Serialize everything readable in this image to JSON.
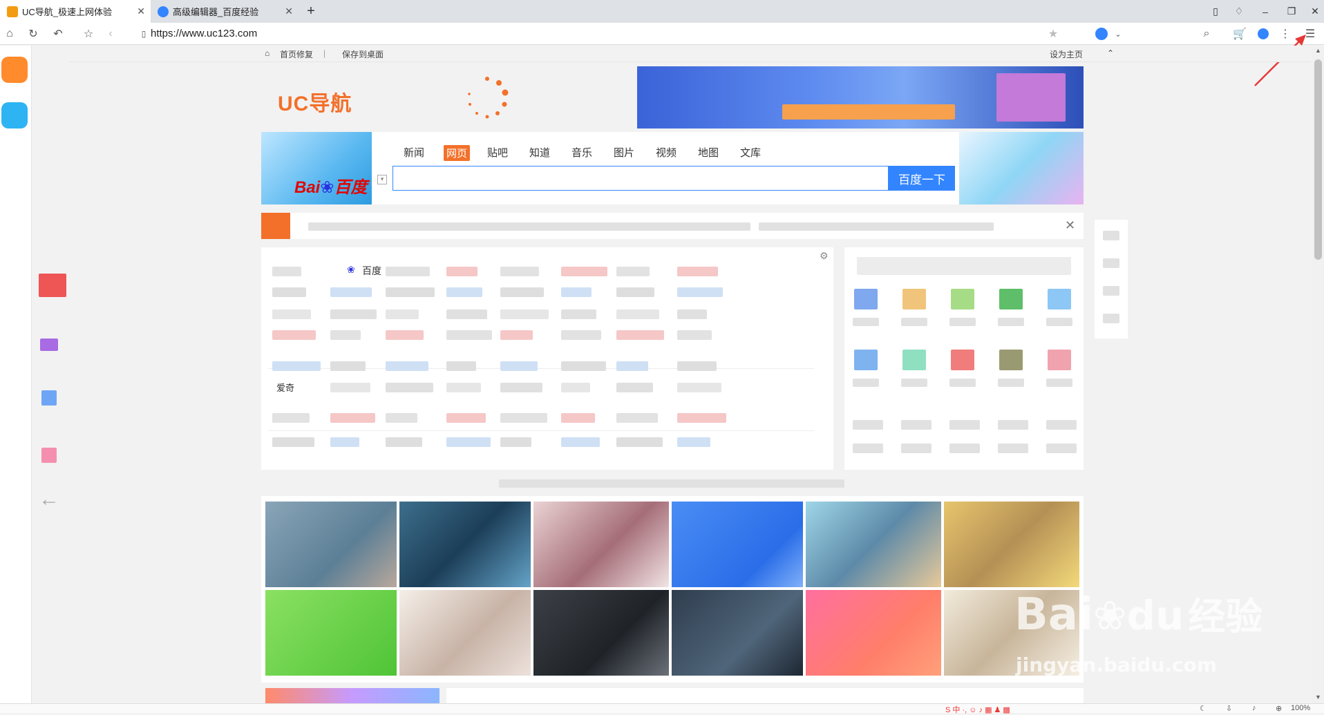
{
  "tabs": [
    {
      "title": "UC导航_极速上网体验",
      "active": true
    },
    {
      "title": "高级编辑器_百度经验",
      "active": false
    }
  ],
  "toolbar": {
    "url": "https://www.uc123.com",
    "search_engine": "百度"
  },
  "favbar": {
    "home_fix": "首页修复",
    "save_desktop": "保存到桌面",
    "set_homepage": "设为主页"
  },
  "logo": {
    "text": "UC导航"
  },
  "search": {
    "brand": "Bai",
    "brand_cn": "百度",
    "tabs": [
      "新闻",
      "网页",
      "贴吧",
      "知道",
      "音乐",
      "图片",
      "视频",
      "地图",
      "文库"
    ],
    "active_tab": "网页",
    "button": "百度一下",
    "input_value": ""
  },
  "sites": {
    "baidu_label": "百度",
    "aiqi_label": "爱奇"
  },
  "status": {
    "zoom": "100%"
  },
  "watermark": {
    "line1": "Bai",
    "line2": "经验",
    "url": "jingyan.baidu.com"
  },
  "colors": {
    "accent": "#f3702a",
    "baidu_blue": "#3385ff",
    "red_arrow": "#e53935"
  }
}
